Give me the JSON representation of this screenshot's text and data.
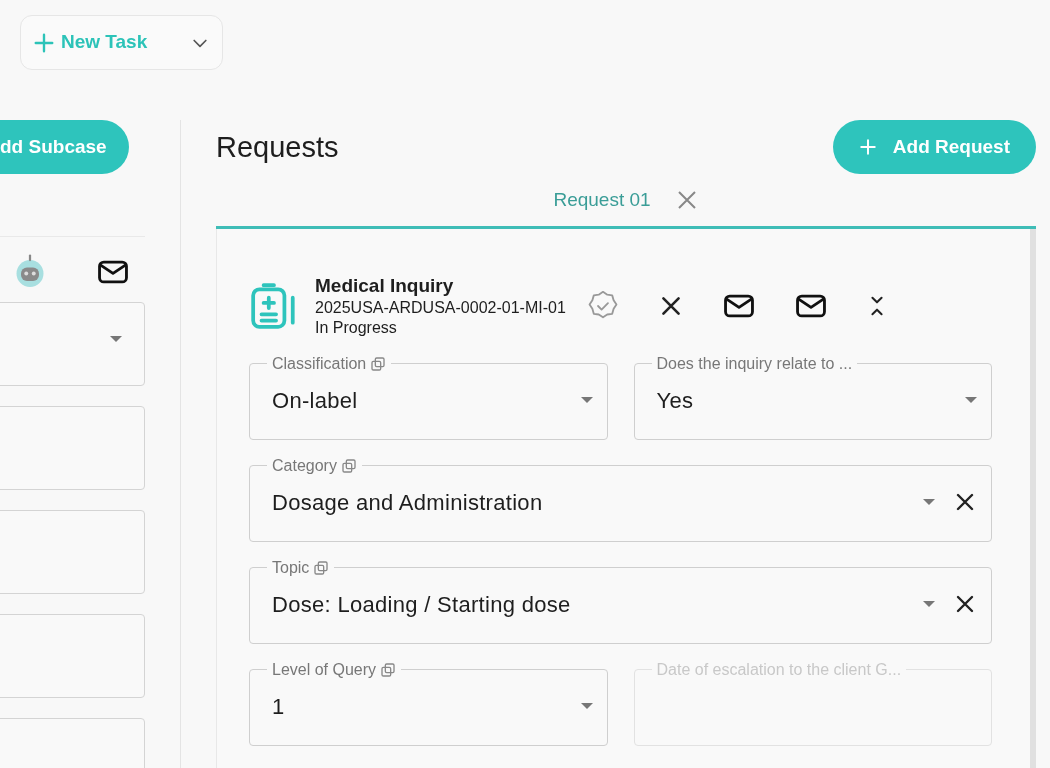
{
  "toolbar": {
    "new_task_button": "New Task"
  },
  "subcases": {
    "add_button": "dd Subcase",
    "fields": [
      {
        "kind": "select"
      },
      {
        "kind": "text"
      },
      {
        "kind": "text"
      },
      {
        "kind": "text"
      },
      {
        "kind": "text"
      }
    ]
  },
  "requests": {
    "title": "Requests",
    "add_button": "Add Request",
    "tabs": [
      {
        "label": "Request 01",
        "selected": true
      }
    ],
    "card": {
      "type": "Medical Inquiry",
      "id": "2025USA-ARDUSA-0002-01-MI-01",
      "status": "In Progress",
      "rows": [
        {
          "fields": [
            {
              "label": "Classification",
              "value": "On-label",
              "copy_icon": true,
              "clearable": false,
              "disabled": false
            },
            {
              "label": "Does the inquiry relate to ...",
              "value": "Yes",
              "copy_icon": false,
              "clearable": false,
              "disabled": false
            }
          ]
        },
        {
          "fields": [
            {
              "label": "Category",
              "value": "Dosage and Administration",
              "copy_icon": true,
              "clearable": true,
              "disabled": false
            }
          ]
        },
        {
          "fields": [
            {
              "label": "Topic",
              "value": "Dose: Loading / Starting dose",
              "copy_icon": true,
              "clearable": true,
              "disabled": false
            }
          ]
        },
        {
          "fields": [
            {
              "label": "Level of Query",
              "value": "1",
              "copy_icon": true,
              "clearable": false,
              "disabled": false
            },
            {
              "label": "Date of escalation to the client G...",
              "copy_icon": false,
              "clearable": false,
              "disabled": true
            }
          ]
        }
      ]
    }
  }
}
